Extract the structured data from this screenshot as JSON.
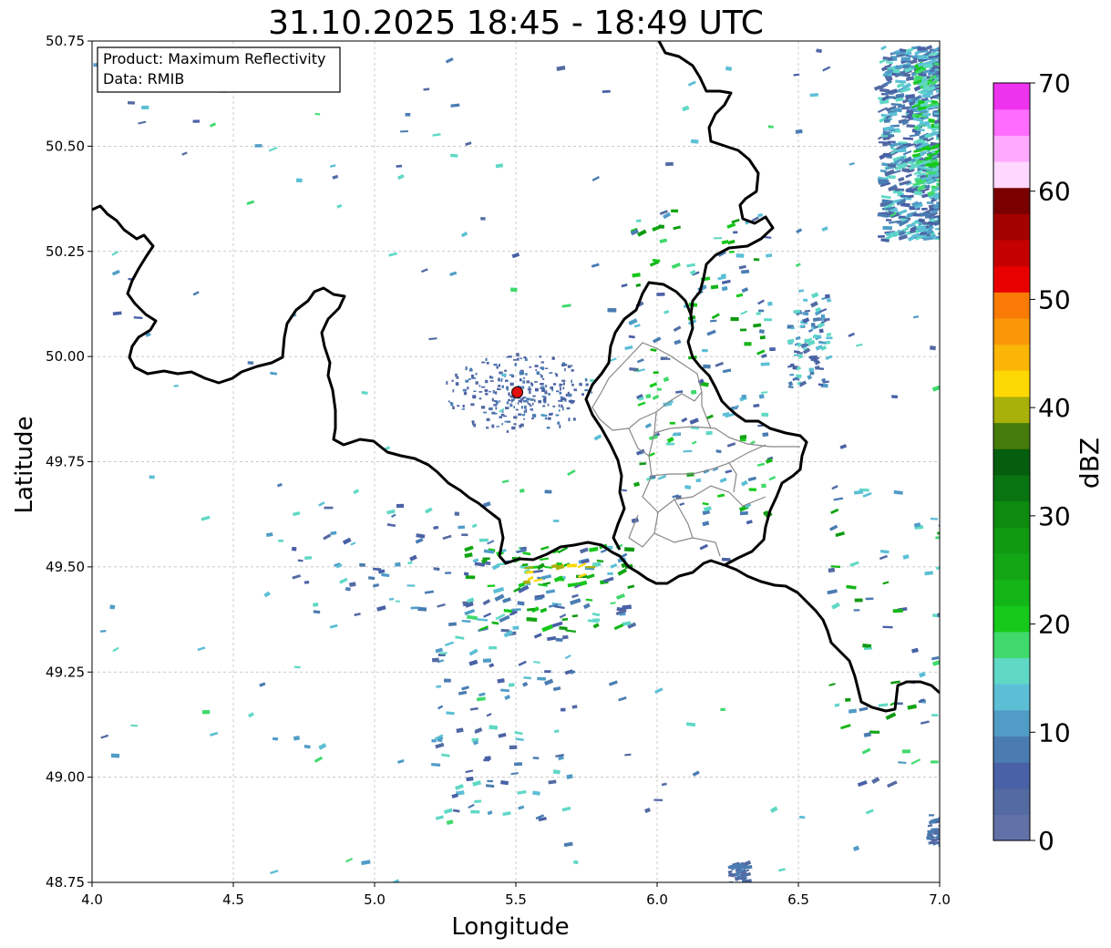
{
  "title": "31.10.2025 18:45 - 18:49 UTC",
  "info_box": {
    "product_line": "Product: Maximum Reflectivity",
    "data_line": "Data: RMIB"
  },
  "axes": {
    "xlabel": "Longitude",
    "ylabel": "Latitude",
    "xlim": [
      4.0,
      7.0
    ],
    "ylim": [
      48.75,
      50.75
    ],
    "x_ticks": [
      "4.0",
      "4.5",
      "5.0",
      "5.5",
      "6.0",
      "6.5",
      "7.0"
    ],
    "y_ticks": [
      "48.75",
      "49.00",
      "49.25",
      "49.50",
      "49.75",
      "50.00",
      "50.25",
      "50.50",
      "50.75"
    ],
    "grid": true
  },
  "radar_site": {
    "lon": 5.505,
    "lat": 49.915,
    "color": "#e01010"
  },
  "colorbar": {
    "label": "dBZ",
    "ticks": [
      "0",
      "10",
      "20",
      "30",
      "40",
      "50",
      "60",
      "70"
    ],
    "colors": [
      "#6271a7",
      "#536aa3",
      "#4961a6",
      "#4a7cb2",
      "#509cc7",
      "#5cbfd6",
      "#60d8c6",
      "#3fd96c",
      "#16c91b",
      "#14b517",
      "#12a514",
      "#0f9a12",
      "#0c8b0f",
      "#087510",
      "#055d0e",
      "#467c0b",
      "#a8b00a",
      "#fcd805",
      "#fab507",
      "#f99709",
      "#f97a05",
      "#e80000",
      "#c40000",
      "#a30000",
      "#7a0000",
      "#ffd8ff",
      "#ffaaff",
      "#ff6cff",
      "#ee33ee"
    ]
  },
  "chart_data": {
    "type": "heatmap",
    "title": "31.10.2025 18:45 - 18:49 UTC",
    "xlabel": "Longitude",
    "ylabel": "Latitude",
    "xlim": [
      4.0,
      7.0
    ],
    "ylim": [
      48.75,
      50.75
    ],
    "colorbar": {
      "label": "dBZ",
      "range": [
        0,
        70
      ]
    },
    "echo_regions": [
      {
        "lon_range": [
          6.75,
          7.0
        ],
        "lat_range": [
          50.25,
          50.75
        ],
        "max_dbz": 20
      },
      {
        "lon_range": [
          6.9,
          7.0
        ],
        "lat_range": [
          50.35,
          50.72
        ],
        "max_dbz": 25
      },
      {
        "lon_range": [
          6.45,
          6.6
        ],
        "lat_range": [
          49.95,
          50.15
        ],
        "max_dbz": 15
      },
      {
        "lon_range": [
          5.4,
          5.9
        ],
        "lat_range": [
          49.35,
          49.55
        ],
        "max_dbz": 40
      },
      {
        "lon_range": [
          5.9,
          6.4
        ],
        "lat_range": [
          49.65,
          50.35
        ],
        "max_dbz": 30
      },
      {
        "lon_range": [
          6.95,
          7.0
        ],
        "lat_range": [
          48.84,
          48.92
        ],
        "max_dbz": 10
      },
      {
        "lon_range": [
          6.25,
          6.32
        ],
        "lat_range": [
          48.75,
          48.8
        ],
        "max_dbz": 10
      }
    ]
  }
}
